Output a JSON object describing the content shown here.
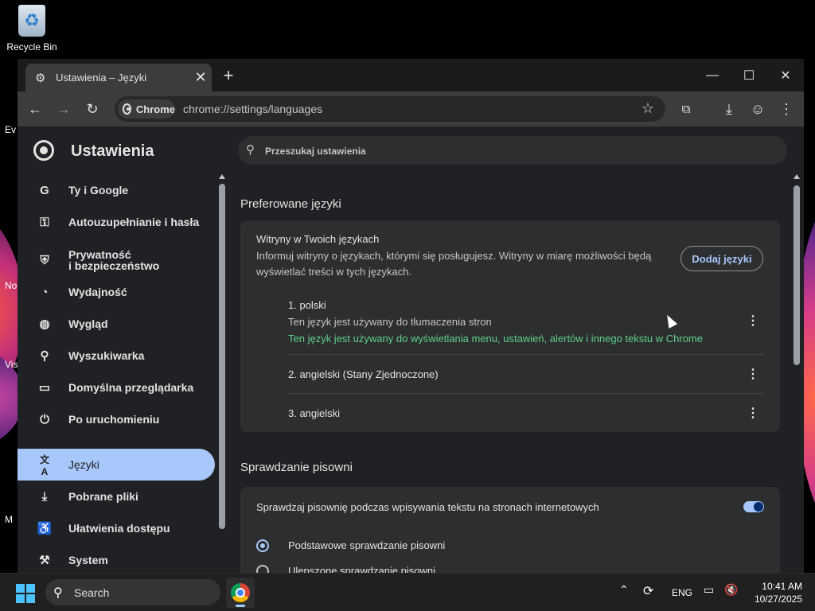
{
  "desktop": {
    "recycle_bin_label": "Recycle Bin",
    "edge_labels": [
      "Ev",
      "No",
      "Visi",
      "M"
    ]
  },
  "browser": {
    "tab_title": "Ustawienia – Języki",
    "tab_close": "✕",
    "new_tab": "+",
    "chip_label": "Chrome",
    "url": "chrome://settings/languages",
    "window_controls": {
      "minimize": "—",
      "maximize": "☐",
      "close": "✕"
    }
  },
  "settings": {
    "title": "Ustawienia",
    "search_placeholder": "Przeszukaj ustawienia",
    "nav": [
      {
        "label": "Ty i Google",
        "icon": "google-icon",
        "glyph": "G"
      },
      {
        "label": "Autouzupełnianie i hasła",
        "icon": "key-icon",
        "glyph": "⚿"
      },
      {
        "label": "Prywatność\ni bezpieczeństwo",
        "icon": "shield-icon",
        "glyph": "⛨"
      },
      {
        "label": "Wydajność",
        "icon": "speedometer-icon",
        "glyph": "◔"
      },
      {
        "label": "Wygląd",
        "icon": "palette-icon",
        "glyph": "◍"
      },
      {
        "label": "Wyszukiwarka",
        "icon": "search-icon",
        "glyph": "⚲"
      },
      {
        "label": "Domyślna przeglądarka",
        "icon": "browser-window-icon",
        "glyph": "▭"
      },
      {
        "label": "Po uruchomieniu",
        "icon": "power-icon",
        "glyph": "⏻"
      },
      {
        "label": "Języki",
        "icon": "translate-icon",
        "glyph": "文A",
        "active": true
      },
      {
        "label": "Pobrane pliki",
        "icon": "download-icon",
        "glyph": "⤓"
      },
      {
        "label": "Ułatwienia dostępu",
        "icon": "accessibility-icon",
        "glyph": "♿"
      },
      {
        "label": "System",
        "icon": "wrench-icon",
        "glyph": "⚒"
      }
    ],
    "preferred": {
      "heading": "Preferowane języki",
      "card_title": "Witryny w Twoich językach",
      "card_desc": "Informuj witryny o językach, którymi się posługujesz. Witryny w miarę możliwości będą wyświetlać treści w tych językach.",
      "add_button": "Dodaj języki",
      "languages": [
        {
          "name": "1. polski",
          "note": "Ten język jest używany do tłumaczenia stron",
          "note2": "Ten język jest używany do wyświetlania menu, ustawień, alertów i innego tekstu w Chrome"
        },
        {
          "name": "2. angielski (Stany Zjednoczone)"
        },
        {
          "name": "3. angielski"
        }
      ],
      "kebab": "⋮"
    },
    "spell": {
      "heading": "Sprawdzanie pisowni",
      "toggle_label": "Sprawdzaj pisownię podczas wpisywania tekstu na stronach internetowych",
      "toggle_on": true,
      "options": [
        {
          "label": "Podstawowe sprawdzanie pisowni",
          "selected": true
        },
        {
          "label": "Ulepszone sprawdzanie pisowni",
          "selected": false
        }
      ]
    }
  },
  "taskbar": {
    "search_label": "Search",
    "language": "ENG",
    "time": "10:41 AM",
    "date": "10/27/2025"
  },
  "colors": {
    "accent": "#a8c7fa",
    "green_note": "#5fd08a",
    "panel": "#2d2e30",
    "background": "#202124"
  }
}
